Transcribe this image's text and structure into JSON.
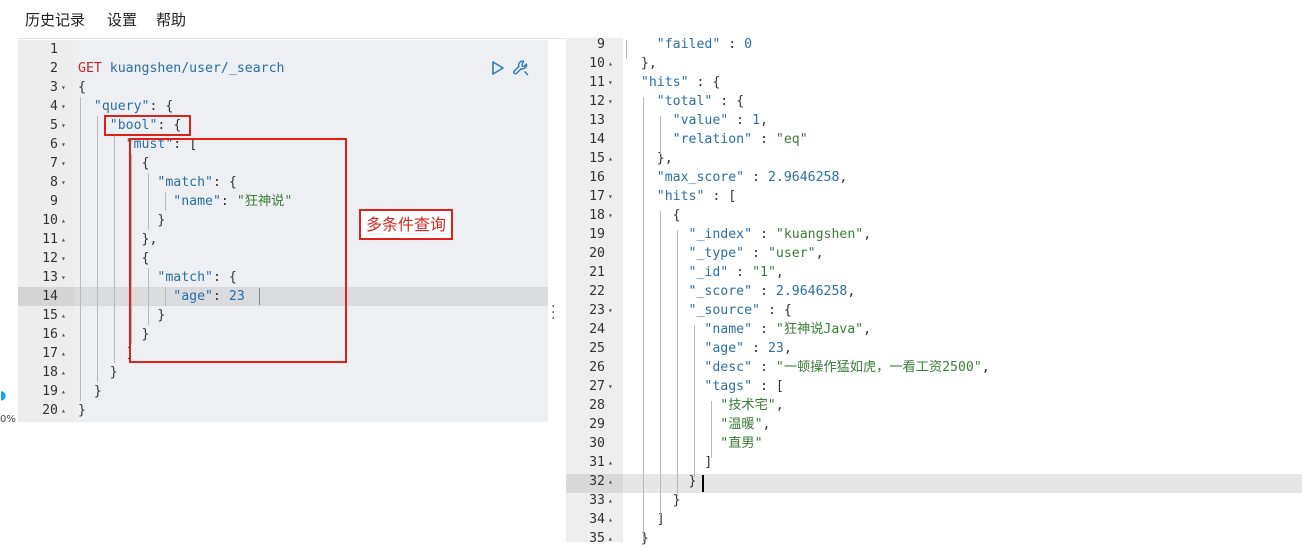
{
  "menu": {
    "history": "历史记录",
    "settings": "设置",
    "help": "帮助"
  },
  "left_strip": {
    "zoom": "0%"
  },
  "request": {
    "method": "GET",
    "url": "kuangshen/user/_search"
  },
  "left_lines": [
    {
      "n": "1",
      "fold": "",
      "code": ""
    },
    {
      "n": "2",
      "fold": "",
      "code": ""
    },
    {
      "n": "3",
      "fold": "▾",
      "code": "{"
    },
    {
      "n": "4",
      "fold": "▾",
      "code": "  \"query\": {"
    },
    {
      "n": "5",
      "fold": "▾",
      "code": "    \"bool\": {"
    },
    {
      "n": "6",
      "fold": "▾",
      "code": "      \"must\": ["
    },
    {
      "n": "7",
      "fold": "▾",
      "code": "        {"
    },
    {
      "n": "8",
      "fold": "▾",
      "code": "          \"match\": {"
    },
    {
      "n": "9",
      "fold": "",
      "code": "            \"name\": \"狂神说\""
    },
    {
      "n": "10",
      "fold": "▴",
      "code": "          }"
    },
    {
      "n": "11",
      "fold": "▴",
      "code": "        },"
    },
    {
      "n": "12",
      "fold": "▾",
      "code": "        {"
    },
    {
      "n": "13",
      "fold": "▾",
      "code": "          \"match\": {"
    },
    {
      "n": "14",
      "fold": "",
      "code": "            \"age\": 23"
    },
    {
      "n": "15",
      "fold": "▴",
      "code": "          }"
    },
    {
      "n": "16",
      "fold": "▴",
      "code": "        }"
    },
    {
      "n": "17",
      "fold": "▴",
      "code": "      ]"
    },
    {
      "n": "18",
      "fold": "▴",
      "code": "    }"
    },
    {
      "n": "19",
      "fold": "▴",
      "code": "  }"
    },
    {
      "n": "20",
      "fold": "▴",
      "code": "}"
    }
  ],
  "annotation": {
    "label": "多条件查询"
  },
  "right_lines": [
    {
      "n": "9",
      "fold": "",
      "code": "    \"failed\" : 0"
    },
    {
      "n": "10",
      "fold": "▴",
      "code": "  },"
    },
    {
      "n": "11",
      "fold": "▾",
      "code": "  \"hits\" : {"
    },
    {
      "n": "12",
      "fold": "▾",
      "code": "    \"total\" : {"
    },
    {
      "n": "13",
      "fold": "",
      "code": "      \"value\" : 1,"
    },
    {
      "n": "14",
      "fold": "",
      "code": "      \"relation\" : \"eq\""
    },
    {
      "n": "15",
      "fold": "▴",
      "code": "    },"
    },
    {
      "n": "16",
      "fold": "",
      "code": "    \"max_score\" : 2.9646258,"
    },
    {
      "n": "17",
      "fold": "▾",
      "code": "    \"hits\" : ["
    },
    {
      "n": "18",
      "fold": "▾",
      "code": "      {"
    },
    {
      "n": "19",
      "fold": "",
      "code": "        \"_index\" : \"kuangshen\","
    },
    {
      "n": "20",
      "fold": "",
      "code": "        \"_type\" : \"user\","
    },
    {
      "n": "21",
      "fold": "",
      "code": "        \"_id\" : \"1\","
    },
    {
      "n": "22",
      "fold": "",
      "code": "        \"_score\" : 2.9646258,"
    },
    {
      "n": "23",
      "fold": "▾",
      "code": "        \"_source\" : {"
    },
    {
      "n": "24",
      "fold": "",
      "code": "          \"name\" : \"狂神说Java\","
    },
    {
      "n": "25",
      "fold": "",
      "code": "          \"age\" : 23,"
    },
    {
      "n": "26",
      "fold": "",
      "code": "          \"desc\" : \"一顿操作猛如虎，一看工资2500\","
    },
    {
      "n": "27",
      "fold": "▾",
      "code": "          \"tags\" : ["
    },
    {
      "n": "28",
      "fold": "",
      "code": "            \"技术宅\","
    },
    {
      "n": "29",
      "fold": "",
      "code": "            \"温暖\","
    },
    {
      "n": "30",
      "fold": "",
      "code": "            \"直男\""
    },
    {
      "n": "31",
      "fold": "▴",
      "code": "          ]"
    },
    {
      "n": "32",
      "fold": "▴",
      "code": "        }"
    },
    {
      "n": "33",
      "fold": "▴",
      "code": "      }"
    },
    {
      "n": "34",
      "fold": "▴",
      "code": "    ]"
    },
    {
      "n": "35",
      "fold": "▴",
      "code": "  }"
    }
  ]
}
